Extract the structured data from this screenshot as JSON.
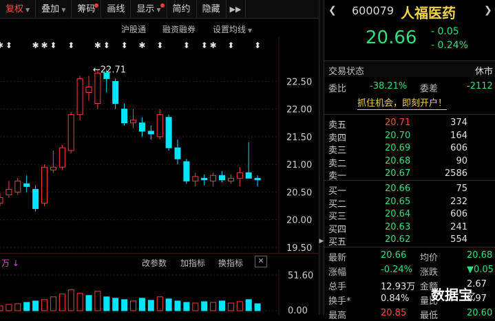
{
  "toolbar": {
    "items": [
      {
        "label": "复权",
        "active": true,
        "caret": true
      },
      {
        "label": "叠加",
        "caret": true
      },
      {
        "label": "筹码",
        "dot": true
      },
      {
        "label": "画线"
      },
      {
        "label": "显示",
        "caret": true,
        "dot": true
      },
      {
        "label": "简约"
      },
      {
        "label": "隐藏"
      }
    ]
  },
  "chart_toolbar": {
    "hgt": "沪股通",
    "margin": "融资融券",
    "ma_settings": "设置均线"
  },
  "chart": {
    "high_marker": "22.71",
    "y_ticks": [
      "22.50",
      "22.00",
      "21.50",
      "21.00",
      "20.50",
      "20.00",
      "19.50"
    ],
    "candles": [
      {
        "o": 20.3,
        "h": 20.48,
        "l": 20.25,
        "c": 20.4
      },
      {
        "o": 20.45,
        "h": 20.7,
        "l": 20.4,
        "c": 20.55
      },
      {
        "o": 20.5,
        "h": 20.75,
        "l": 20.45,
        "c": 20.7
      },
      {
        "o": 20.65,
        "h": 20.8,
        "l": 20.5,
        "c": 20.6
      },
      {
        "o": 20.55,
        "h": 20.62,
        "l": 20.15,
        "c": 20.2
      },
      {
        "o": 20.3,
        "h": 21.0,
        "l": 20.25,
        "c": 20.95
      },
      {
        "o": 20.9,
        "h": 21.25,
        "l": 20.85,
        "c": 20.95
      },
      {
        "o": 20.95,
        "h": 21.35,
        "l": 20.9,
        "c": 21.3
      },
      {
        "o": 21.25,
        "h": 21.95,
        "l": 21.2,
        "c": 21.9
      },
      {
        "o": 21.9,
        "h": 22.6,
        "l": 21.8,
        "c": 22.55
      },
      {
        "o": 22.3,
        "h": 22.6,
        "l": 22.15,
        "c": 22.4
      },
      {
        "o": 22.1,
        "h": 22.71,
        "l": 22.0,
        "c": 22.65
      },
      {
        "o": 22.65,
        "h": 22.71,
        "l": 22.3,
        "c": 22.55
      },
      {
        "o": 22.5,
        "h": 22.55,
        "l": 22.0,
        "c": 22.1
      },
      {
        "o": 22.0,
        "h": 22.1,
        "l": 21.7,
        "c": 21.75
      },
      {
        "o": 21.75,
        "h": 22.0,
        "l": 21.65,
        "c": 21.8
      },
      {
        "o": 21.75,
        "h": 21.85,
        "l": 21.5,
        "c": 21.6
      },
      {
        "o": 21.6,
        "h": 21.7,
        "l": 21.45,
        "c": 21.55
      },
      {
        "o": 21.5,
        "h": 22.0,
        "l": 21.45,
        "c": 21.9
      },
      {
        "o": 21.85,
        "h": 21.9,
        "l": 21.25,
        "c": 21.3
      },
      {
        "o": 21.3,
        "h": 21.45,
        "l": 21.0,
        "c": 21.1
      },
      {
        "o": 21.05,
        "h": 21.1,
        "l": 20.65,
        "c": 20.7
      },
      {
        "o": 20.7,
        "h": 20.85,
        "l": 20.6,
        "c": 20.78
      },
      {
        "o": 20.75,
        "h": 20.82,
        "l": 20.62,
        "c": 20.72
      },
      {
        "o": 20.7,
        "h": 20.85,
        "l": 20.6,
        "c": 20.8
      },
      {
        "o": 20.8,
        "h": 20.88,
        "l": 20.68,
        "c": 20.72
      },
      {
        "o": 20.7,
        "h": 20.82,
        "l": 20.65,
        "c": 20.75
      },
      {
        "o": 20.75,
        "h": 20.95,
        "l": 20.6,
        "c": 20.85
      },
      {
        "o": 20.85,
        "h": 21.4,
        "l": 20.8,
        "c": 20.75
      },
      {
        "o": 20.75,
        "h": 20.8,
        "l": 20.6,
        "c": 20.72
      }
    ],
    "markers": [
      "✱",
      "⬍",
      "",
      "",
      "✱",
      "✱",
      "⬍",
      "",
      "⬍",
      "",
      "",
      "✱",
      "⬍",
      "",
      "⬍",
      "",
      "✱",
      "",
      "⬍",
      "",
      "",
      "⬍",
      "",
      "⬍",
      "✱",
      "",
      "⬍",
      "",
      "",
      "⬍"
    ]
  },
  "volume": {
    "unit": "万",
    "change_param": "改参数",
    "add_indicator": "加指标",
    "switch_indicator": "换指标",
    "close": "✕",
    "y_ticks": [
      "51.60",
      "0.00"
    ],
    "values": [
      7,
      9,
      10,
      12,
      14,
      16,
      20,
      24,
      30,
      25,
      22,
      28,
      20,
      18,
      16,
      14,
      18,
      15,
      20,
      17,
      14,
      12,
      11,
      13,
      12,
      14,
      11,
      13,
      16,
      10
    ],
    "up": [
      true,
      true,
      true,
      false,
      false,
      true,
      true,
      true,
      true,
      true,
      false,
      true,
      false,
      false,
      false,
      true,
      false,
      false,
      true,
      false,
      false,
      false,
      true,
      false,
      true,
      false,
      true,
      true,
      false,
      false
    ]
  },
  "panel": {
    "code": "600079",
    "name": "人福医药",
    "price": "20.66",
    "change": "- 0.05",
    "change_pct": "- 0.24%",
    "status_label": "交易状态",
    "status_value": "休市",
    "wb_label": "委比",
    "wb_value": "-38.21%",
    "wc_label": "委差",
    "wc_value": "-2112",
    "promo": "抓住机会，即刻开户！",
    "asks": [
      {
        "label": "卖五",
        "price": "20.71",
        "vol": "374",
        "cls": "red"
      },
      {
        "label": "卖四",
        "price": "20.70",
        "vol": "164",
        "cls": "green"
      },
      {
        "label": "卖三",
        "price": "20.69",
        "vol": "606",
        "cls": "green"
      },
      {
        "label": "卖二",
        "price": "20.68",
        "vol": "90",
        "cls": "green"
      },
      {
        "label": "卖一",
        "price": "20.67",
        "vol": "2586",
        "cls": "green"
      }
    ],
    "bids": [
      {
        "label": "买一",
        "price": "20.66",
        "vol": "75",
        "cls": "green"
      },
      {
        "label": "买二",
        "price": "20.65",
        "vol": "232",
        "cls": "green"
      },
      {
        "label": "买三",
        "price": "20.64",
        "vol": "606",
        "cls": "green"
      },
      {
        "label": "买四",
        "price": "20.63",
        "vol": "241",
        "cls": "green"
      },
      {
        "label": "买五",
        "price": "20.62",
        "vol": "554",
        "cls": "green"
      }
    ],
    "stats": [
      {
        "l1": "最新",
        "v1": "20.66",
        "c1": "green",
        "l2": "均价",
        "v2": "20.68",
        "c2": "green"
      },
      {
        "l1": "涨幅",
        "v1": "-0.24%",
        "c1": "green",
        "l2": "涨跌",
        "v2": "▼0.05",
        "c2": "green"
      },
      {
        "l1": "总手",
        "v1": "12.93万",
        "c1": "white",
        "l2": "金额",
        "v2": "2.67亿",
        "c2": "white"
      },
      {
        "l1": "换手*",
        "v1": "0.84%",
        "c1": "white",
        "l2": "量比",
        "v2": "0.97",
        "c2": "white"
      },
      {
        "l1": "最高",
        "v1": "20.85",
        "c1": "red",
        "l2": "最低",
        "v2": "20.60",
        "c2": "green"
      }
    ]
  },
  "watermark": "数据宝",
  "colors": {
    "up": "#ff3b3b",
    "down": "#00e5ff",
    "bg": "#000000"
  }
}
